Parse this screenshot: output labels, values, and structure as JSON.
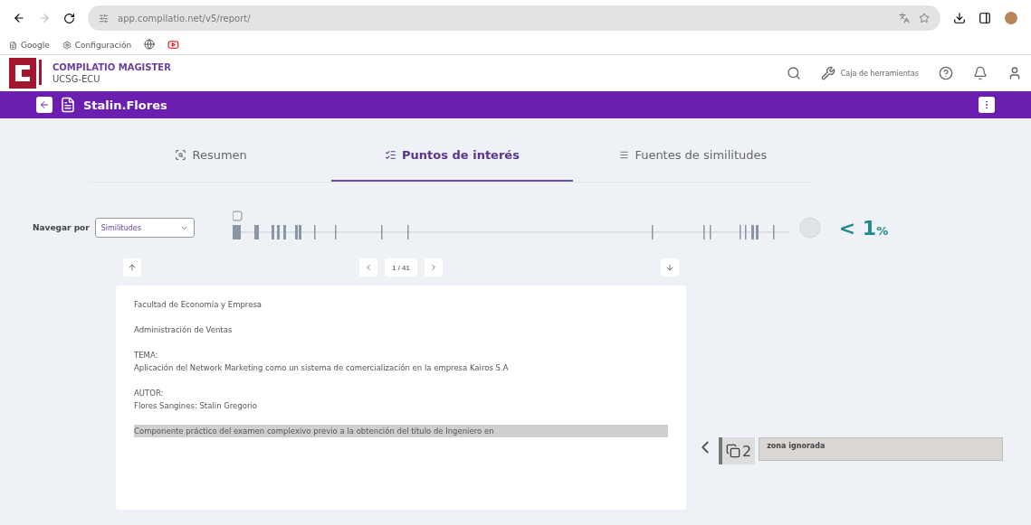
{
  "browser": {
    "url": "app.compilatio.net/v5/report/",
    "bookmarks": [
      {
        "label": "Google",
        "kind": "text"
      },
      {
        "label": "Configuración",
        "kind": "text"
      },
      {
        "kind": "globe"
      },
      {
        "kind": "video"
      }
    ]
  },
  "app": {
    "brand": "COMPILATIO MAGISTER",
    "org": "UCSG-ECU",
    "toolbox": "Caja de herramientas"
  },
  "document": {
    "title": "Stalin.Flores"
  },
  "tabs": [
    {
      "label": "Resumen",
      "selected": false,
      "kind": "summary"
    },
    {
      "label": "Puntos de interés",
      "selected": true,
      "kind": "points"
    },
    {
      "label": "Fuentes de similitudes",
      "selected": false,
      "kind": "sources"
    }
  ],
  "navigate": {
    "label": "Navegar por",
    "value": "Similitudes",
    "percent": "< 1",
    "percent_unit": "%"
  },
  "pager": {
    "position": "1 / 41"
  },
  "paragraphs": [
    {
      "lines": [
        "Facultad de Economía y Empresa"
      ],
      "highlighted": false
    },
    {
      "lines": [
        "Administración de Ventas"
      ],
      "highlighted": false
    },
    {
      "lines": [
        "TEMA:",
        "Aplicación del Network Marketing como un sistema de comercialización en la empresa Kairos S.A"
      ],
      "highlighted": false
    },
    {
      "lines": [
        "AUTOR:",
        "Flores Sangines: Stalin Gregorio"
      ],
      "highlighted": false
    },
    {
      "lines": [
        "Componente práctico del examen complexivo previo a la obtención del título de Ingeniero en"
      ],
      "highlighted": true
    }
  ],
  "side": {
    "count": "2",
    "label": "zona ignorada"
  }
}
